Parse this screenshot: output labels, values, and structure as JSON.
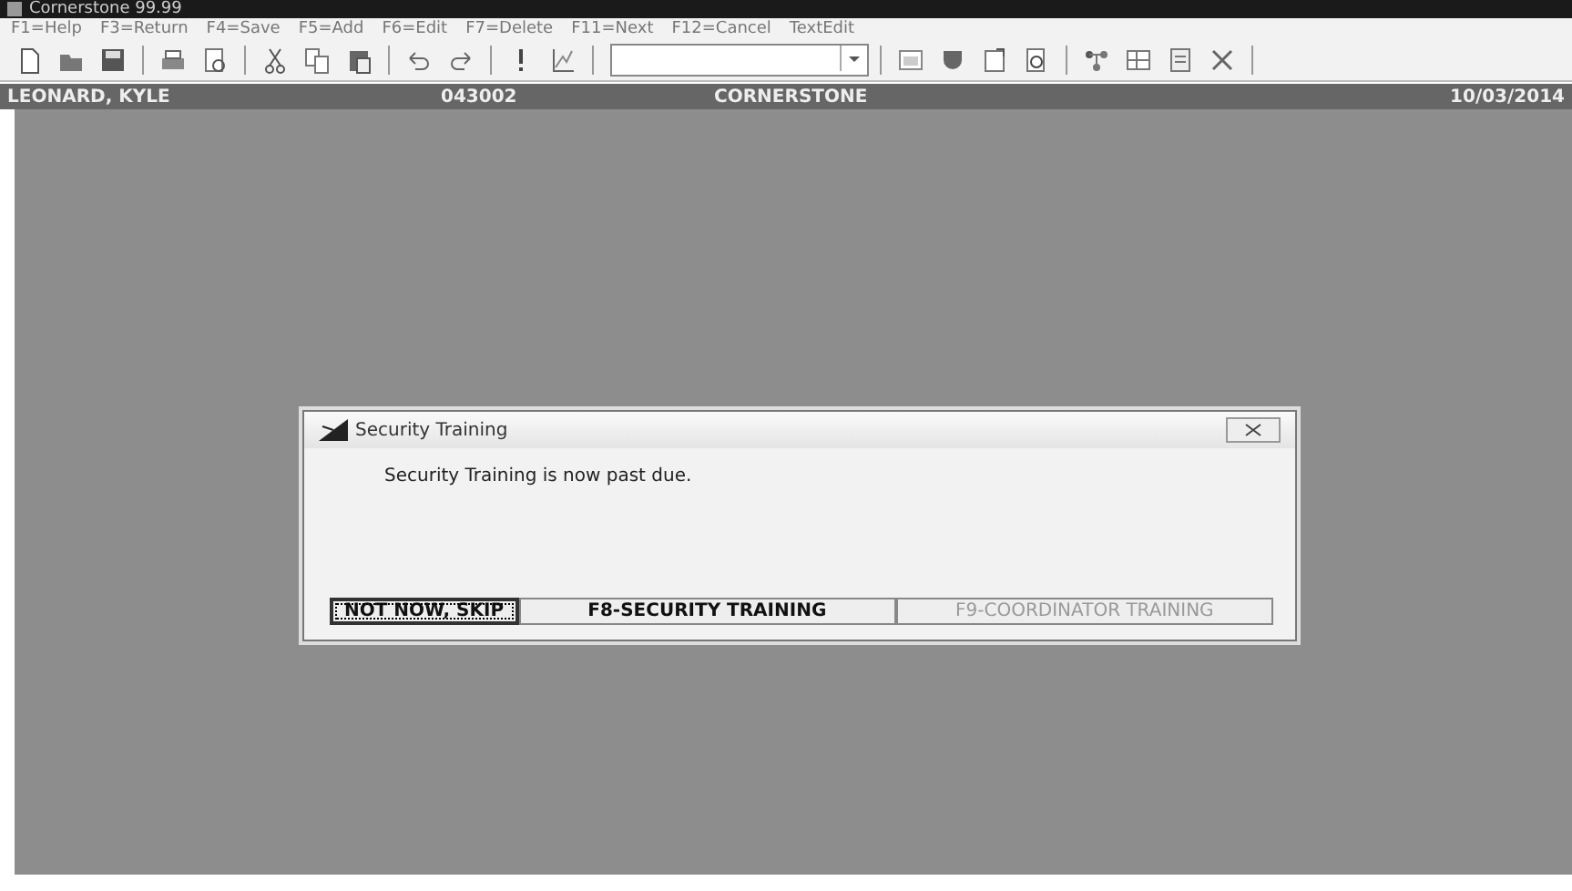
{
  "window": {
    "title": "Cornerstone 99.99"
  },
  "menu": [
    {
      "label": "F1=Help"
    },
    {
      "label": "F3=Return"
    },
    {
      "label": "F4=Save"
    },
    {
      "label": "F5=Add"
    },
    {
      "label": "F6=Edit"
    },
    {
      "label": "F7=Delete"
    },
    {
      "label": "F11=Next"
    },
    {
      "label": "F12=Cancel"
    },
    {
      "label": "TextEdit"
    }
  ],
  "header": {
    "name": "LEONARD, KYLE",
    "code": "043002",
    "site": "CORNERSTONE",
    "date": "10/03/2014"
  },
  "dialog": {
    "title": "Security Training",
    "message": "Security Training is now past due.",
    "buttons": [
      {
        "label": "NOT NOW, SKIP",
        "focused": true,
        "disabled": false
      },
      {
        "label": "F8-SECURITY TRAINING",
        "focused": false,
        "disabled": false
      },
      {
        "label": "F9-COORDINATOR TRAINING",
        "focused": false,
        "disabled": true
      }
    ]
  }
}
